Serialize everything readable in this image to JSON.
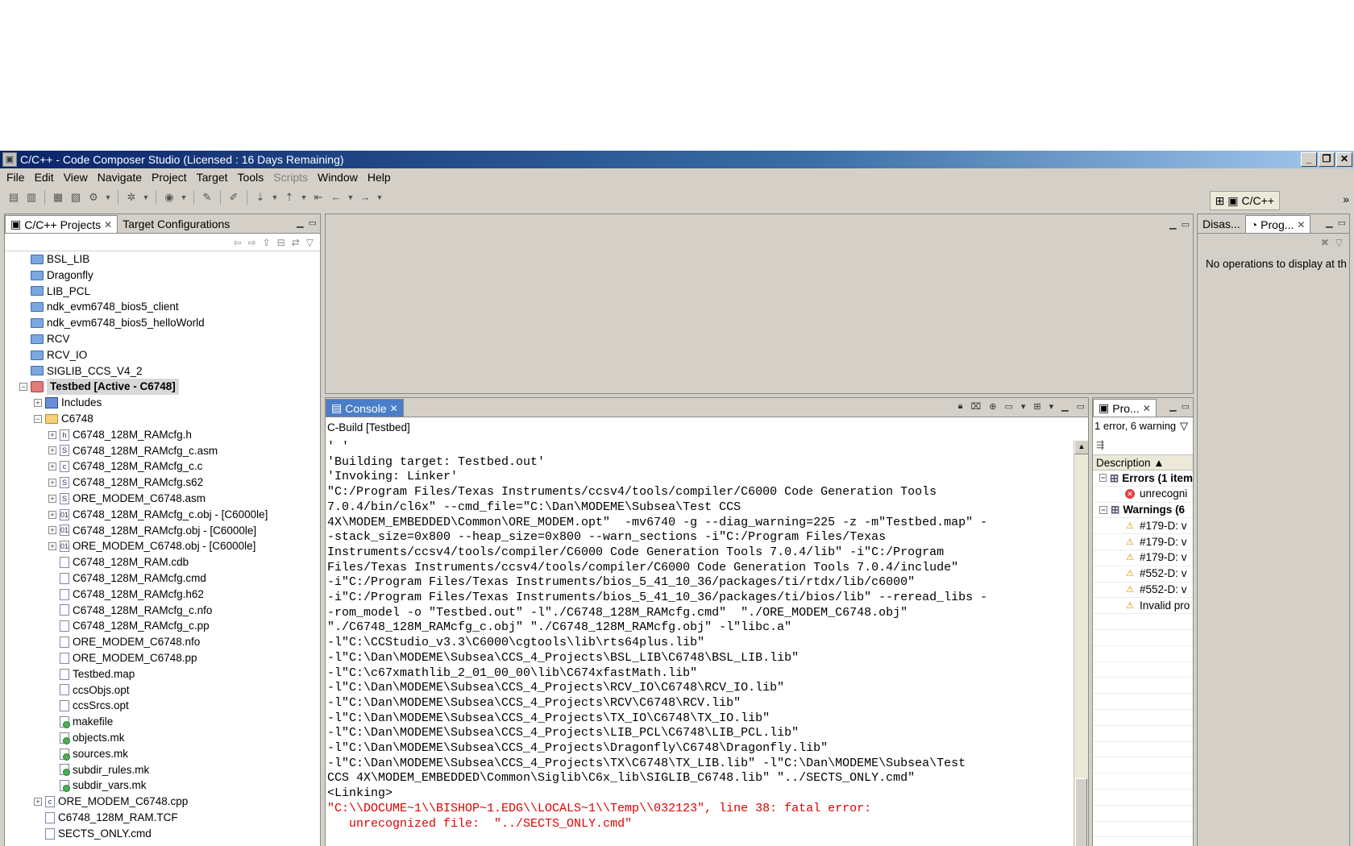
{
  "window": {
    "title": "C/C++ - Code Composer Studio (Licensed : 16 Days Remaining)",
    "controls": [
      "_",
      "❐",
      "✕"
    ]
  },
  "menu": [
    "File",
    "Edit",
    "View",
    "Navigate",
    "Project",
    "Target",
    "Tools",
    "Scripts",
    "Window",
    "Help"
  ],
  "perspective": {
    "label": "C/C++",
    "more": "»"
  },
  "projects_panel": {
    "tabs": [
      "C/C++ Projects",
      "Target Configurations"
    ],
    "tree": [
      {
        "label": "BSL_LIB",
        "icon": "folder-icon",
        "depth": 0,
        "expander": ""
      },
      {
        "label": "Dragonfly",
        "icon": "folder-icon",
        "depth": 0,
        "expander": ""
      },
      {
        "label": "LIB_PCL",
        "icon": "folder-icon",
        "depth": 0,
        "expander": ""
      },
      {
        "label": "ndk_evm6748_bios5_client",
        "icon": "folder-icon",
        "depth": 0,
        "expander": ""
      },
      {
        "label": "ndk_evm6748_bios5_helloWorld",
        "icon": "folder-icon",
        "depth": 0,
        "expander": ""
      },
      {
        "label": "RCV",
        "icon": "folder-icon",
        "depth": 0,
        "expander": ""
      },
      {
        "label": "RCV_IO",
        "icon": "folder-icon",
        "depth": 0,
        "expander": ""
      },
      {
        "label": "SIGLIB_CCS_V4_2",
        "icon": "folder-icon",
        "depth": 0,
        "expander": ""
      },
      {
        "label": "Testbed  [Active - C6748]",
        "icon": "project-icon",
        "depth": 0,
        "expander": "-",
        "active": true
      },
      {
        "label": "Includes",
        "icon": "includes-icon",
        "depth": 1,
        "expander": "+"
      },
      {
        "label": "C6748",
        "icon": "open-folder-icon",
        "depth": 1,
        "expander": "-"
      },
      {
        "label": "C6748_128M_RAMcfg.h",
        "icon": "header-file-icon",
        "depth": 2,
        "expander": "+",
        "glyph": "h"
      },
      {
        "label": "C6748_128M_RAMcfg_c.asm",
        "icon": "asm-file-icon",
        "depth": 2,
        "expander": "+",
        "glyph": "S"
      },
      {
        "label": "C6748_128M_RAMcfg_c.c",
        "icon": "c-file-icon",
        "depth": 2,
        "expander": "+",
        "glyph": "c"
      },
      {
        "label": "C6748_128M_RAMcfg.s62",
        "icon": "asm-file-icon",
        "depth": 2,
        "expander": "+",
        "glyph": "S"
      },
      {
        "label": "ORE_MODEM_C6748.asm",
        "icon": "asm-file-icon",
        "depth": 2,
        "expander": "+",
        "glyph": "S"
      },
      {
        "label": "C6748_128M_RAMcfg_c.obj - [C6000le]",
        "icon": "object-file-icon",
        "depth": 2,
        "expander": "+",
        "glyph": "01"
      },
      {
        "label": "C6748_128M_RAMcfg.obj - [C6000le]",
        "icon": "object-file-icon",
        "depth": 2,
        "expander": "+",
        "glyph": "01"
      },
      {
        "label": "ORE_MODEM_C6748.obj - [C6000le]",
        "icon": "object-file-icon",
        "depth": 2,
        "expander": "+",
        "glyph": "01"
      },
      {
        "label": "C6748_128M_RAM.cdb",
        "icon": "file-icon",
        "depth": 2,
        "expander": ""
      },
      {
        "label": "C6748_128M_RAMcfg.cmd",
        "icon": "cmd-file-icon",
        "depth": 2,
        "expander": ""
      },
      {
        "label": "C6748_128M_RAMcfg.h62",
        "icon": "file-icon",
        "depth": 2,
        "expander": ""
      },
      {
        "label": "C6748_128M_RAMcfg_c.nfo",
        "icon": "file-icon",
        "depth": 2,
        "expander": ""
      },
      {
        "label": "C6748_128M_RAMcfg_c.pp",
        "icon": "file-icon",
        "depth": 2,
        "expander": ""
      },
      {
        "label": "ORE_MODEM_C6748.nfo",
        "icon": "file-icon",
        "depth": 2,
        "expander": ""
      },
      {
        "label": "ORE_MODEM_C6748.pp",
        "icon": "file-icon",
        "depth": 2,
        "expander": ""
      },
      {
        "label": "Testbed.map",
        "icon": "file-icon",
        "depth": 2,
        "expander": ""
      },
      {
        "label": "ccsObjs.opt",
        "icon": "file-icon",
        "depth": 2,
        "expander": ""
      },
      {
        "label": "ccsSrcs.opt",
        "icon": "file-icon",
        "depth": 2,
        "expander": ""
      },
      {
        "label": "makefile",
        "icon": "makefile-icon",
        "depth": 2,
        "expander": ""
      },
      {
        "label": "objects.mk",
        "icon": "makefile-icon",
        "depth": 2,
        "expander": ""
      },
      {
        "label": "sources.mk",
        "icon": "makefile-icon",
        "depth": 2,
        "expander": ""
      },
      {
        "label": "subdir_rules.mk",
        "icon": "makefile-icon",
        "depth": 2,
        "expander": ""
      },
      {
        "label": "subdir_vars.mk",
        "icon": "makefile-icon",
        "depth": 2,
        "expander": ""
      },
      {
        "label": "ORE_MODEM_C6748.cpp",
        "icon": "cpp-file-icon",
        "depth": 1,
        "expander": "+",
        "glyph": "c"
      },
      {
        "label": "C6748_128M_RAM.TCF",
        "icon": "tcf-file-icon",
        "depth": 1,
        "expander": ""
      },
      {
        "label": "SECTS_ONLY.cmd",
        "icon": "file-icon",
        "depth": 1,
        "expander": ""
      }
    ]
  },
  "right_panel": {
    "tabs": [
      "Disas...",
      "Prog..."
    ],
    "message": "No operations to display at th"
  },
  "console": {
    "tab": "Console",
    "subtitle": "C-Build [Testbed]",
    "lines": [
      {
        "text": "' '",
        "error": false
      },
      {
        "text": "'Building target: Testbed.out'",
        "error": false
      },
      {
        "text": "'Invoking: Linker'",
        "error": false
      },
      {
        "text": "\"C:/Program Files/Texas Instruments/ccsv4/tools/compiler/C6000 Code Generation Tools\n7.0.4/bin/cl6x\" --cmd_file=\"C:\\Dan\\MODEME\\Subsea\\Test CCS\n4X\\MODEM_EMBEDDED\\Common\\ORE_MODEM.opt\"  -mv6740 -g --diag_warning=225 -z -m\"Testbed.map\" -\n-stack_size=0x800 --heap_size=0x800 --warn_sections -i\"C:/Program Files/Texas\nInstruments/ccsv4/tools/compiler/C6000 Code Generation Tools 7.0.4/lib\" -i\"C:/Program\nFiles/Texas Instruments/ccsv4/tools/compiler/C6000 Code Generation Tools 7.0.4/include\"\n-i\"C:/Program Files/Texas Instruments/bios_5_41_10_36/packages/ti/rtdx/lib/c6000\"\n-i\"C:/Program Files/Texas Instruments/bios_5_41_10_36/packages/ti/bios/lib\" --reread_libs -\n-rom_model -o \"Testbed.out\" -l\"./C6748_128M_RAMcfg.cmd\"  \"./ORE_MODEM_C6748.obj\"\n\"./C6748_128M_RAMcfg_c.obj\" \"./C6748_128M_RAMcfg.obj\" -l\"libc.a\"\n-l\"C:\\CCStudio_v3.3\\C6000\\cgtools\\lib\\rts64plus.lib\"\n-l\"C:\\Dan\\MODEME\\Subsea\\CCS_4_Projects\\BSL_LIB\\C6748\\BSL_LIB.lib\"\n-l\"C:\\c67xmathlib_2_01_00_00\\lib\\C674xfastMath.lib\"\n-l\"C:\\Dan\\MODEME\\Subsea\\CCS_4_Projects\\RCV_IO\\C6748\\RCV_IO.lib\"\n-l\"C:\\Dan\\MODEME\\Subsea\\CCS_4_Projects\\RCV\\C6748\\RCV.lib\"\n-l\"C:\\Dan\\MODEME\\Subsea\\CCS_4_Projects\\TX_IO\\C6748\\TX_IO.lib\"\n-l\"C:\\Dan\\MODEME\\Subsea\\CCS_4_Projects\\LIB_PCL\\C6748\\LIB_PCL.lib\"\n-l\"C:\\Dan\\MODEME\\Subsea\\CCS_4_Projects\\Dragonfly\\C6748\\Dragonfly.lib\"\n-l\"C:\\Dan\\MODEME\\Subsea\\CCS_4_Projects\\TX\\C6748\\TX_LIB.lib\" -l\"C:\\Dan\\MODEME\\Subsea\\Test\nCCS 4X\\MODEM_EMBEDDED\\Common\\Siglib\\C6x_lib\\SIGLIB_C6748.lib\" \"../SECTS_ONLY.cmd\"",
        "error": false
      },
      {
        "text": "<Linking>",
        "error": false
      },
      {
        "text": "\"C:\\\\DOCUME~1\\\\BISHOP~1.EDG\\\\LOCALS~1\\\\Temp\\\\032123\", line 38: fatal error:\n   unrecognized file:  \"../SECTS_ONLY.cmd\"",
        "error": true
      }
    ]
  },
  "problems": {
    "tab": "Pro...",
    "summary": "1 error, 6 warning",
    "column": "Description",
    "groups": [
      {
        "label": "Errors (1 item",
        "kind": "errors",
        "items": [
          "unrecogni"
        ]
      },
      {
        "label": "Warnings (6",
        "kind": "warnings",
        "items": [
          "#179-D: v",
          "#179-D: v",
          "#179-D: v",
          "#552-D: v",
          "#552-D: v",
          "Invalid pro"
        ]
      }
    ]
  }
}
